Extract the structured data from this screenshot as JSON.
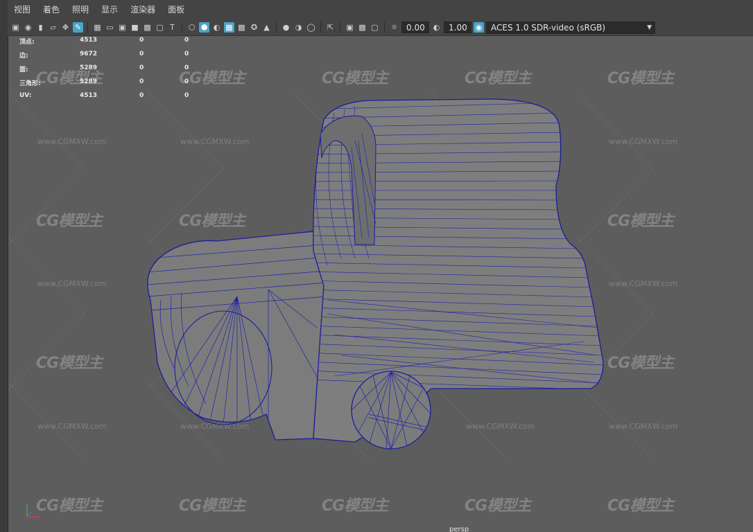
{
  "menu": [
    "视图",
    "着色",
    "照明",
    "显示",
    "渲染器",
    "面板"
  ],
  "toolbar": {
    "exposure_value": "0.00",
    "gamma_value": "1.00",
    "color_space": "ACES 1.0 SDR-video (sRGB)",
    "icons": [
      "select-camera-icon",
      "camera-attributes-icon",
      "bookmark-icon",
      "image-plane-icon",
      "2d-pan-icon",
      "grease-pencil-icon",
      "grid-icon",
      "film-gate-icon",
      "resolution-gate-icon",
      "gate-mask-icon",
      "field-chart-icon",
      "safe-action-icon",
      "safe-title-icon",
      "wireframe-icon",
      "smooth-shade-icon",
      "use-default-material-icon",
      "wireframe-on-shaded-icon",
      "xray-icon",
      "default-lighting-icon",
      "shadows-icon",
      "screen-space-ao-icon",
      "motion-blur-icon",
      "anti-aliasing-icon",
      "isolate-select-icon",
      "xray-joints-icon",
      "xray-active-icon",
      "backface-culling-icon",
      "exposure-icon",
      "gamma-icon",
      "color-management-icon"
    ],
    "active_icons": [
      "smooth-shade-icon",
      "wireframe-on-shaded-icon",
      "grease-pencil-icon"
    ]
  },
  "hud": {
    "rows": [
      {
        "label": "顶点:",
        "v1": "4513",
        "v2": "0",
        "v3": "0"
      },
      {
        "label": "边:",
        "v1": "9672",
        "v2": "0",
        "v3": "0"
      },
      {
        "label": "面:",
        "v1": "5289",
        "v2": "0",
        "v3": "0"
      },
      {
        "label": "三角形:",
        "v1": "5289",
        "v2": "0",
        "v3": "0"
      },
      {
        "label": "UV:",
        "v1": "4513",
        "v2": "0",
        "v3": "0"
      }
    ]
  },
  "watermark": {
    "logo_text": "CG模型主",
    "url_text": "www.CGMXW.com"
  },
  "camera_label": "persp",
  "colors": {
    "viewport_bg": "#5d5d5d",
    "mesh_fill": "#7a7a7a",
    "wire": "#1c1c9e",
    "accent": "#4aa3c9"
  }
}
